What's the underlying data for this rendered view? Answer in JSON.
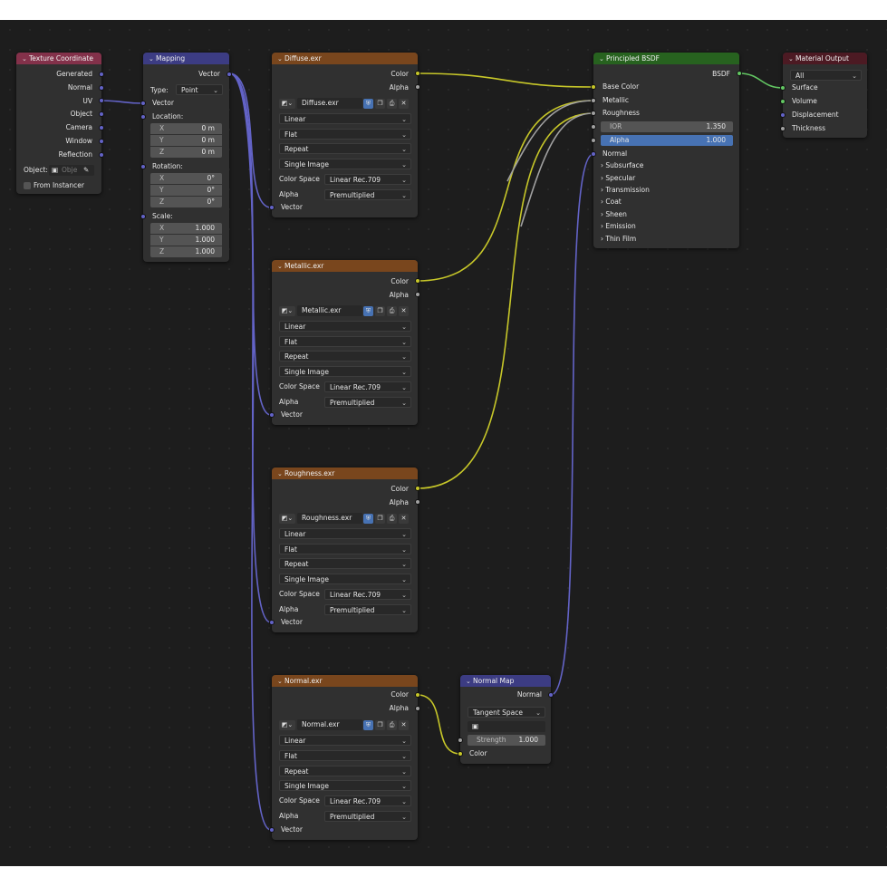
{
  "nodes": {
    "texture_coordinate": {
      "title": "Texture Coordinate",
      "outputs": [
        "Generated",
        "Normal",
        "UV",
        "Object",
        "Camera",
        "Window",
        "Reflection"
      ],
      "object_label": "Object:",
      "object_placeholder": "Obje",
      "from_instancer": "From Instancer"
    },
    "mapping": {
      "title": "Mapping",
      "output": "Vector",
      "type_label": "Type:",
      "type_value": "Point",
      "vector_input": "Vector",
      "location_label": "Location:",
      "location": [
        {
          "k": "X",
          "v": "0 m"
        },
        {
          "k": "Y",
          "v": "0 m"
        },
        {
          "k": "Z",
          "v": "0 m"
        }
      ],
      "rotation_label": "Rotation:",
      "rotation": [
        {
          "k": "X",
          "v": "0°"
        },
        {
          "k": "Y",
          "v": "0°"
        },
        {
          "k": "Z",
          "v": "0°"
        }
      ],
      "scale_label": "Scale:",
      "scale": [
        {
          "k": "X",
          "v": "1.000"
        },
        {
          "k": "Y",
          "v": "1.000"
        },
        {
          "k": "Z",
          "v": "1.000"
        }
      ]
    },
    "image_textures": [
      {
        "title": "Diffuse.exr",
        "image": "Diffuse.exr"
      },
      {
        "title": "Metallic.exr",
        "image": "Metallic.exr"
      },
      {
        "title": "Roughness.exr",
        "image": "Roughness.exr"
      },
      {
        "title": "Normal.exr",
        "image": "Normal.exr"
      }
    ],
    "image_common": {
      "out_color": "Color",
      "out_alpha": "Alpha",
      "interpolation": "Linear",
      "projection": "Flat",
      "extension": "Repeat",
      "source": "Single Image",
      "color_space_label": "Color Space",
      "color_space": "Linear Rec.709",
      "alpha_label": "Alpha",
      "alpha_mode": "Premultiplied",
      "vector_input": "Vector"
    },
    "normal_map": {
      "title": "Normal Map",
      "output": "Normal",
      "space": "Tangent Space",
      "strength_label": "Strength",
      "strength": "1.000",
      "color_input": "Color"
    },
    "principled_bsdf": {
      "title": "Principled BSDF",
      "output": "BSDF",
      "inputs": [
        "Base Color",
        "Metallic",
        "Roughness"
      ],
      "ior_label": "IOR",
      "ior": "1.350",
      "alpha_label": "Alpha",
      "alpha": "1.000",
      "normal_input": "Normal",
      "panels": [
        "Subsurface",
        "Specular",
        "Transmission",
        "Coat",
        "Sheen",
        "Emission",
        "Thin Film"
      ]
    },
    "material_output": {
      "title": "Material Output",
      "target": "All",
      "inputs": [
        "Surface",
        "Volume",
        "Displacement",
        "Thickness"
      ]
    }
  },
  "colors": {
    "header_input": "#83314a",
    "header_vector": "#3c3c83",
    "header_texture": "#79461d",
    "header_shader": "#27621f",
    "header_output": "#4c1a23",
    "socket_vector": "#6363c7",
    "socket_color": "#c7c729",
    "socket_value": "#a1a1a1",
    "socket_shader": "#63c763",
    "slider_fill": "#4772b3"
  }
}
